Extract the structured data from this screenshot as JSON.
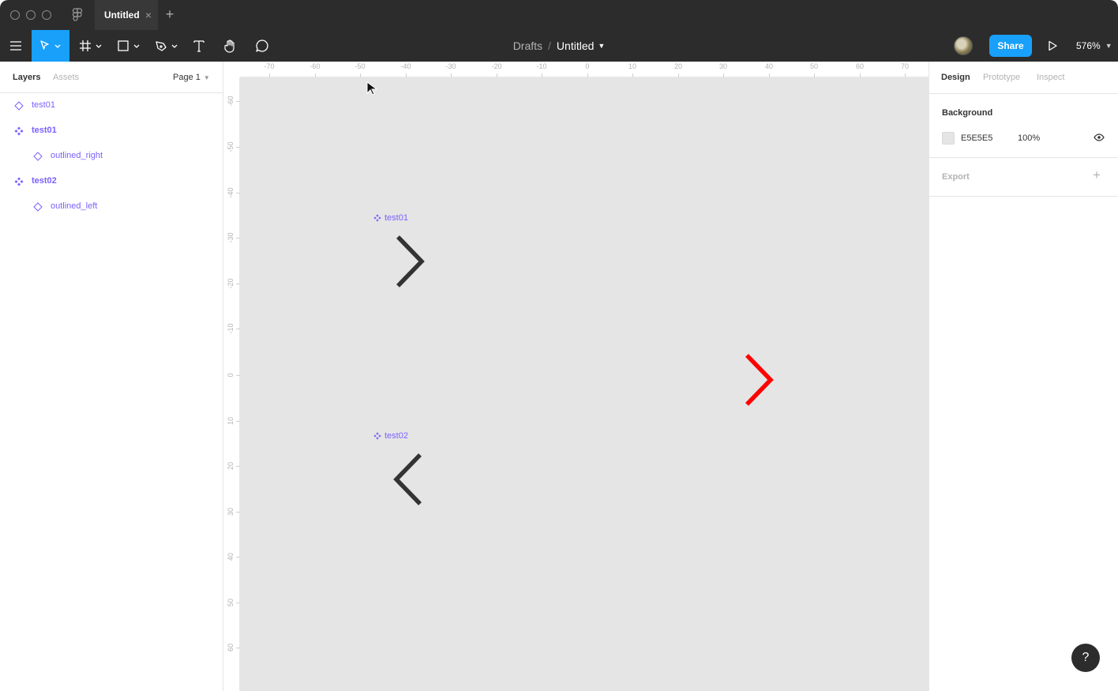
{
  "window": {
    "tab_title": "Untitled",
    "tab_close_icon": "close-icon",
    "tab_add_icon": "plus-icon"
  },
  "toolbar": {
    "tools": [
      "menu-icon",
      "move-tool-icon",
      "frame-tool-icon",
      "shape-tool-icon",
      "pen-tool-icon",
      "text-tool-icon",
      "hand-tool-icon",
      "comment-tool-icon"
    ],
    "active_tool": "move-tool-icon",
    "breadcrumb_parent": "Drafts",
    "breadcrumb_separator": "/",
    "file_name": "Untitled",
    "share_label": "Share",
    "zoom_label": "576%"
  },
  "left_panel": {
    "tabs": [
      {
        "label": "Layers",
        "active": true
      },
      {
        "label": "Assets",
        "active": false
      }
    ],
    "page_selector": "Page 1",
    "layers": [
      {
        "label": "test01",
        "type": "instance",
        "indent": 0
      },
      {
        "label": "test01",
        "type": "component",
        "indent": 0
      },
      {
        "label": "outlined_right",
        "type": "instance",
        "indent": 1
      },
      {
        "label": "test02",
        "type": "component",
        "indent": 0
      },
      {
        "label": "outlined_left",
        "type": "instance",
        "indent": 1
      }
    ]
  },
  "canvas": {
    "background": "#E5E5E5",
    "ruler_h": [
      "-70",
      "-60",
      "-50",
      "-40",
      "-30",
      "-20",
      "-10",
      "0",
      "10",
      "20",
      "30",
      "40",
      "50",
      "60",
      "70"
    ],
    "ruler_v": [
      "-60",
      "-50",
      "-40",
      "-30",
      "-20",
      "-10",
      "0",
      "10",
      "20",
      "30",
      "40",
      "50",
      "60"
    ],
    "frames": [
      {
        "label": "test01",
        "icon": "component-icon",
        "content": "chevron-right-icon",
        "color": "#333333"
      },
      {
        "label": "test02",
        "icon": "component-icon",
        "content": "chevron-left-icon",
        "color": "#333333"
      }
    ],
    "loose_shape": {
      "content": "chevron-right-icon",
      "color": "#FF0000"
    }
  },
  "right_panel": {
    "tabs": [
      {
        "label": "Design",
        "active": true
      },
      {
        "label": "Prototype",
        "active": false
      },
      {
        "label": "Inspect",
        "active": false
      }
    ],
    "background_title": "Background",
    "background_hex": "E5E5E5",
    "background_opacity": "100%",
    "export_title": "Export",
    "help_label": "?"
  },
  "colors": {
    "accent": "#18A0FB",
    "component": "#7B61FF",
    "toolbar": "#2C2C2C"
  }
}
